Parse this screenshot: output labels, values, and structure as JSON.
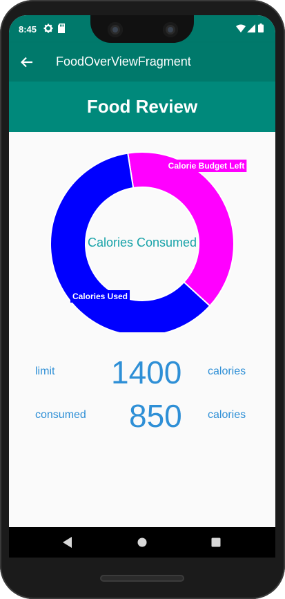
{
  "status_bar": {
    "time": "8:45",
    "icons": [
      "settings-icon",
      "sd-card-icon",
      "wifi-icon",
      "signal-icon",
      "battery-icon"
    ]
  },
  "app_bar": {
    "back_icon": "arrow-back-icon",
    "title": "FoodOverViewFragment"
  },
  "header": {
    "title": "Food Review"
  },
  "chart_data": {
    "type": "pie",
    "donut": true,
    "center_text": "Calories Consumed",
    "slices": [
      {
        "label": "Calorie Budget Left",
        "value": 550,
        "color": "#ff00ff"
      },
      {
        "label": "Calories Used",
        "value": 850,
        "color": "#0000ff"
      }
    ]
  },
  "stats": {
    "limit": {
      "label": "limit",
      "value": "1400",
      "unit": "calories"
    },
    "consumed": {
      "label": "consumed",
      "value": "850",
      "unit": "calories"
    }
  },
  "nav_bar": {
    "buttons": [
      "back-triangle-icon",
      "home-circle-icon",
      "recents-square-icon"
    ]
  },
  "colors": {
    "primary": "#00796b",
    "banner": "#00897b",
    "stat_text": "#2e8fd6",
    "center_text": "#17a2a8"
  }
}
